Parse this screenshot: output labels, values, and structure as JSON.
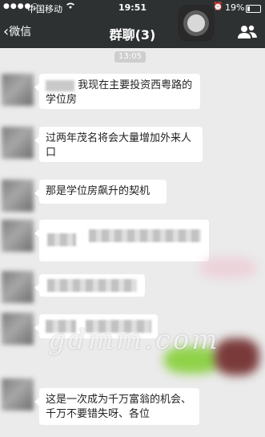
{
  "status_bar": {
    "carrier": "中国移动",
    "time": "19:51",
    "battery_text": "19%",
    "battery_level": 0.19
  },
  "nav": {
    "back_label": "微信",
    "title": "群聊(3)"
  },
  "chat": {
    "timestamp": "13:05",
    "messages": [
      {
        "text": "我现在主要投资西粤路的学位房"
      },
      {
        "text": "过两年茂名将会大量增加外来人口"
      },
      {
        "text": "那是学位房飙升的契机"
      },
      {
        "text": "这是一次成为千万富翁的机会、千万不要错失呀、各位"
      }
    ]
  },
  "watermark": "gdmm.com",
  "colors": {
    "bar": "#2e3132",
    "chat_background": "#ebebeb",
    "bubble": "#ffffff"
  }
}
